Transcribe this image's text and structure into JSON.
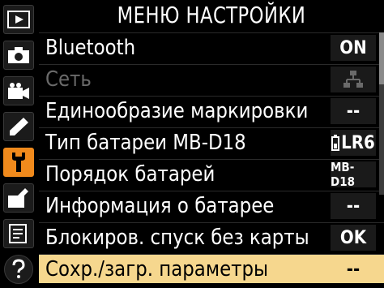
{
  "header": {
    "title": "МЕНЮ НАСТРОЙКИ"
  },
  "sidebar": {
    "tabs": [
      {
        "icon": "playback-icon"
      },
      {
        "icon": "camera-icon"
      },
      {
        "icon": "movie-icon"
      },
      {
        "icon": "pencil-icon"
      },
      {
        "icon": "wrench-icon",
        "active": true
      },
      {
        "icon": "retouch-icon"
      },
      {
        "icon": "my-menu-icon"
      },
      {
        "icon": "help-icon"
      }
    ]
  },
  "rows": [
    {
      "label": "Bluetooth",
      "value": "ON"
    },
    {
      "label": "Сеть",
      "value": "",
      "disabled": true,
      "value_icon": "network-icon"
    },
    {
      "label": "Единообразие маркировки",
      "value": "--"
    },
    {
      "label": "Тип батареи MB-D18",
      "value": "LR6"
    },
    {
      "label": "Порядок батарей",
      "value": "MB-D18"
    },
    {
      "label": "Информация о батарее",
      "value": "--"
    },
    {
      "label": "Блокиров. спуск без карты",
      "value": "OK"
    },
    {
      "label": "Сохр./загр. параметры",
      "value": "--",
      "selected": true
    }
  ],
  "colors": {
    "accent": "#f08a1c",
    "selection": "#f6d78e",
    "background": "#000000"
  }
}
